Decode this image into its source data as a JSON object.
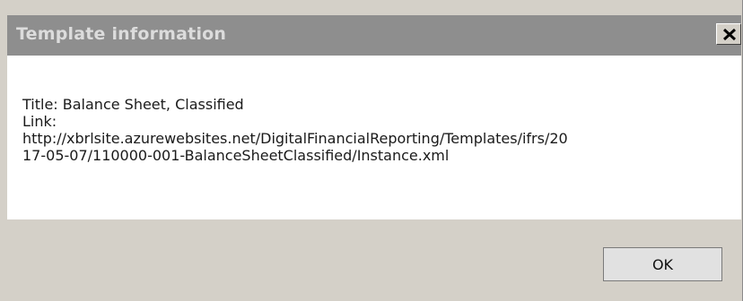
{
  "dialog": {
    "title": "Template information",
    "close_label": "close",
    "info_lines": [
      "Title: Balance Sheet, Classified",
      "Link:",
      "http://xbrlsite.azurewebsites.net/DigitalFinancialReporting/Templates/ifrs/20",
      "17-05-07/110000-001-BalanceSheetClassified/Instance.xml"
    ],
    "ok_label": "OK"
  },
  "colors": {
    "titlebar": "#8e8e8e",
    "title_text": "#dcdcdc",
    "content_bg": "#ffffff",
    "dialog_bg": "#d4d0c8"
  },
  "icons": {
    "close": "close-icon"
  }
}
